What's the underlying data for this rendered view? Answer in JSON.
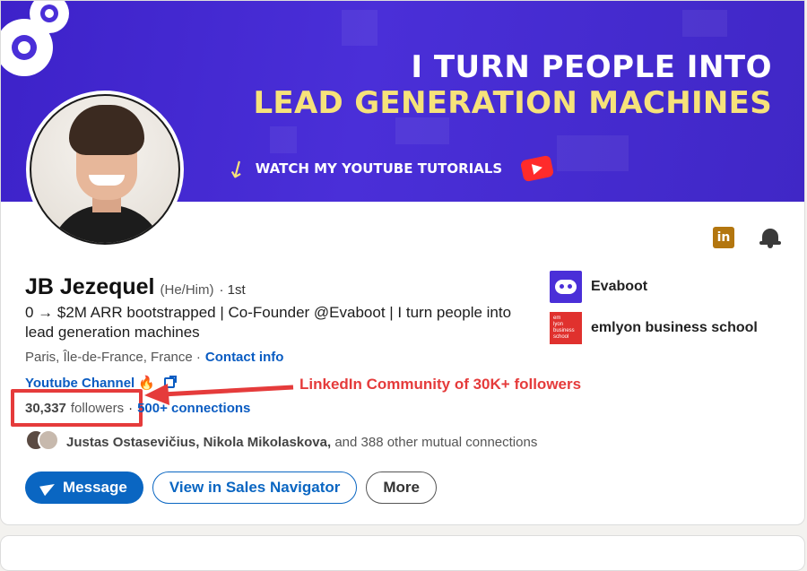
{
  "banner": {
    "headline_line1": "I TURN PEOPLE INTO",
    "headline_line2": "LEAD GENERATION MACHINES",
    "cta_text": "WATCH MY YOUTUBE TUTORIALS",
    "bg_color": "#4a2fd8",
    "accent_color": "#f6e27a",
    "icons": [
      "gear-icon",
      "arrow-icon",
      "youtube-play-icon"
    ]
  },
  "profile": {
    "name": "JB Jezequel",
    "pronouns": "(He/Him)",
    "degree": "· 1st",
    "headline": "0 → $2M ARR bootstrapped | Co-Founder @Evaboot | I turn people into lead generation machines",
    "location": "Paris, Île-de-France, France ·",
    "contact_info": "Contact info",
    "youtube_link": "Youtube Channel 🔥",
    "followers_count": "30,337",
    "followers_label": "followers",
    "separator": "·",
    "connections": "500+ connections",
    "mutual_names": "Justas Ostasevičius, Nikola Mikolaskova,",
    "mutual_rest": "and 388 other mutual connections"
  },
  "top_icons": [
    "linkedin-icon",
    "bell-icon"
  ],
  "linkedin_icon_text": "in",
  "companies": [
    {
      "name": "Evaboot",
      "logo": "evaboot-logo"
    },
    {
      "name": "emlyon business school",
      "logo": "emlyon-logo",
      "logo_text": [
        "em",
        "lyon",
        "business",
        "school"
      ]
    }
  ],
  "buttons": {
    "message": "Message",
    "sales_navigator": "View in Sales Navigator",
    "more": "More"
  },
  "annotation": {
    "text": "LinkedIn Community of 30K+ followers",
    "color": "#e53b3b"
  },
  "link_color": "#0a66c2"
}
